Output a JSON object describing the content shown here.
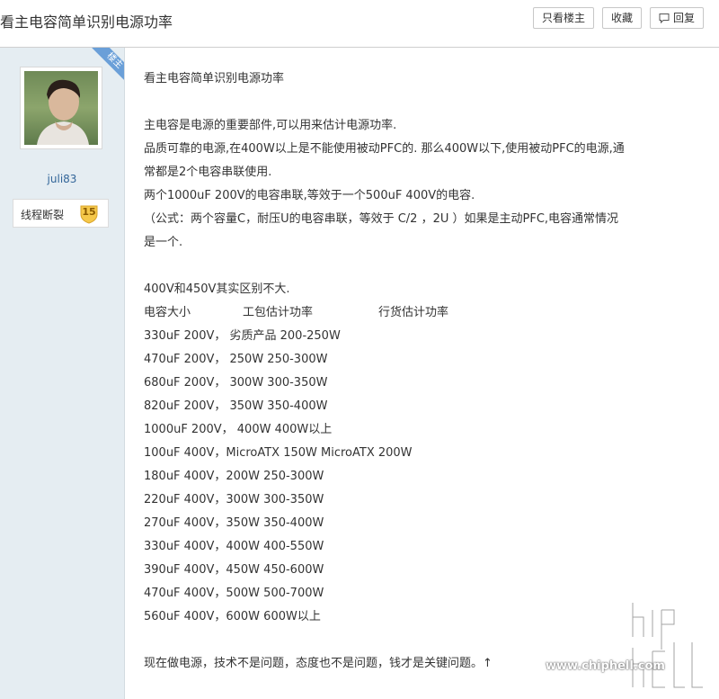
{
  "header": {
    "title": "看主电容简单识别电源功率",
    "buttons": {
      "only_op": "只看楼主",
      "favorite": "收藏",
      "reply": "回复"
    }
  },
  "author": {
    "ribbon": "楼主",
    "username": "juli83",
    "level_name": "线程断裂",
    "level_number": "15"
  },
  "post": {
    "title_line": "看主电容简单识别电源功率",
    "intro": [
      "主电容是电源的重要部件,可以用来估计电源功率.",
      "品质可靠的电源,在400W以上是不能使用被动PFC的. 那么400W以下,使用被动PFC的电源,通",
      "常都是2个电容串联使用.",
      "两个1000uF 200V的电容串联,等效于一个500uF 400V的电容.",
      "（公式：两个容量C，耐压U的电容串联，等效于 C/2 ，2U ）如果是主动PFC,电容通常情况",
      "是一个."
    ],
    "note": "400V和450V其实区别不大.",
    "table_header": [
      "电容大小",
      "工包估计功率",
      "行货估计功率"
    ],
    "rows": [
      "330uF 200V， 劣质产品 200-250W",
      "470uF 200V， 250W 250-300W",
      "680uF 200V， 300W 300-350W",
      "820uF 200V， 350W 350-400W",
      "1000uF 200V， 400W 400W以上",
      "100uF 400V，MicroATX 150W MicroATX 200W",
      "180uF 400V，200W 250-300W",
      "220uF 400V，300W 300-350W",
      "270uF 400V，350W 350-400W",
      "330uF 400V，400W 400-550W",
      "390uF 400V，450W 450-600W",
      "470uF 400V，500W 500-700W",
      "560uF 400V，600W 600W以上"
    ],
    "closing": "现在做电源，技术不是问题，态度也不是问题，钱才是关键问题。↑"
  },
  "watermark": {
    "logo_text": "chip hell",
    "url": "www.chiphell.com"
  }
}
